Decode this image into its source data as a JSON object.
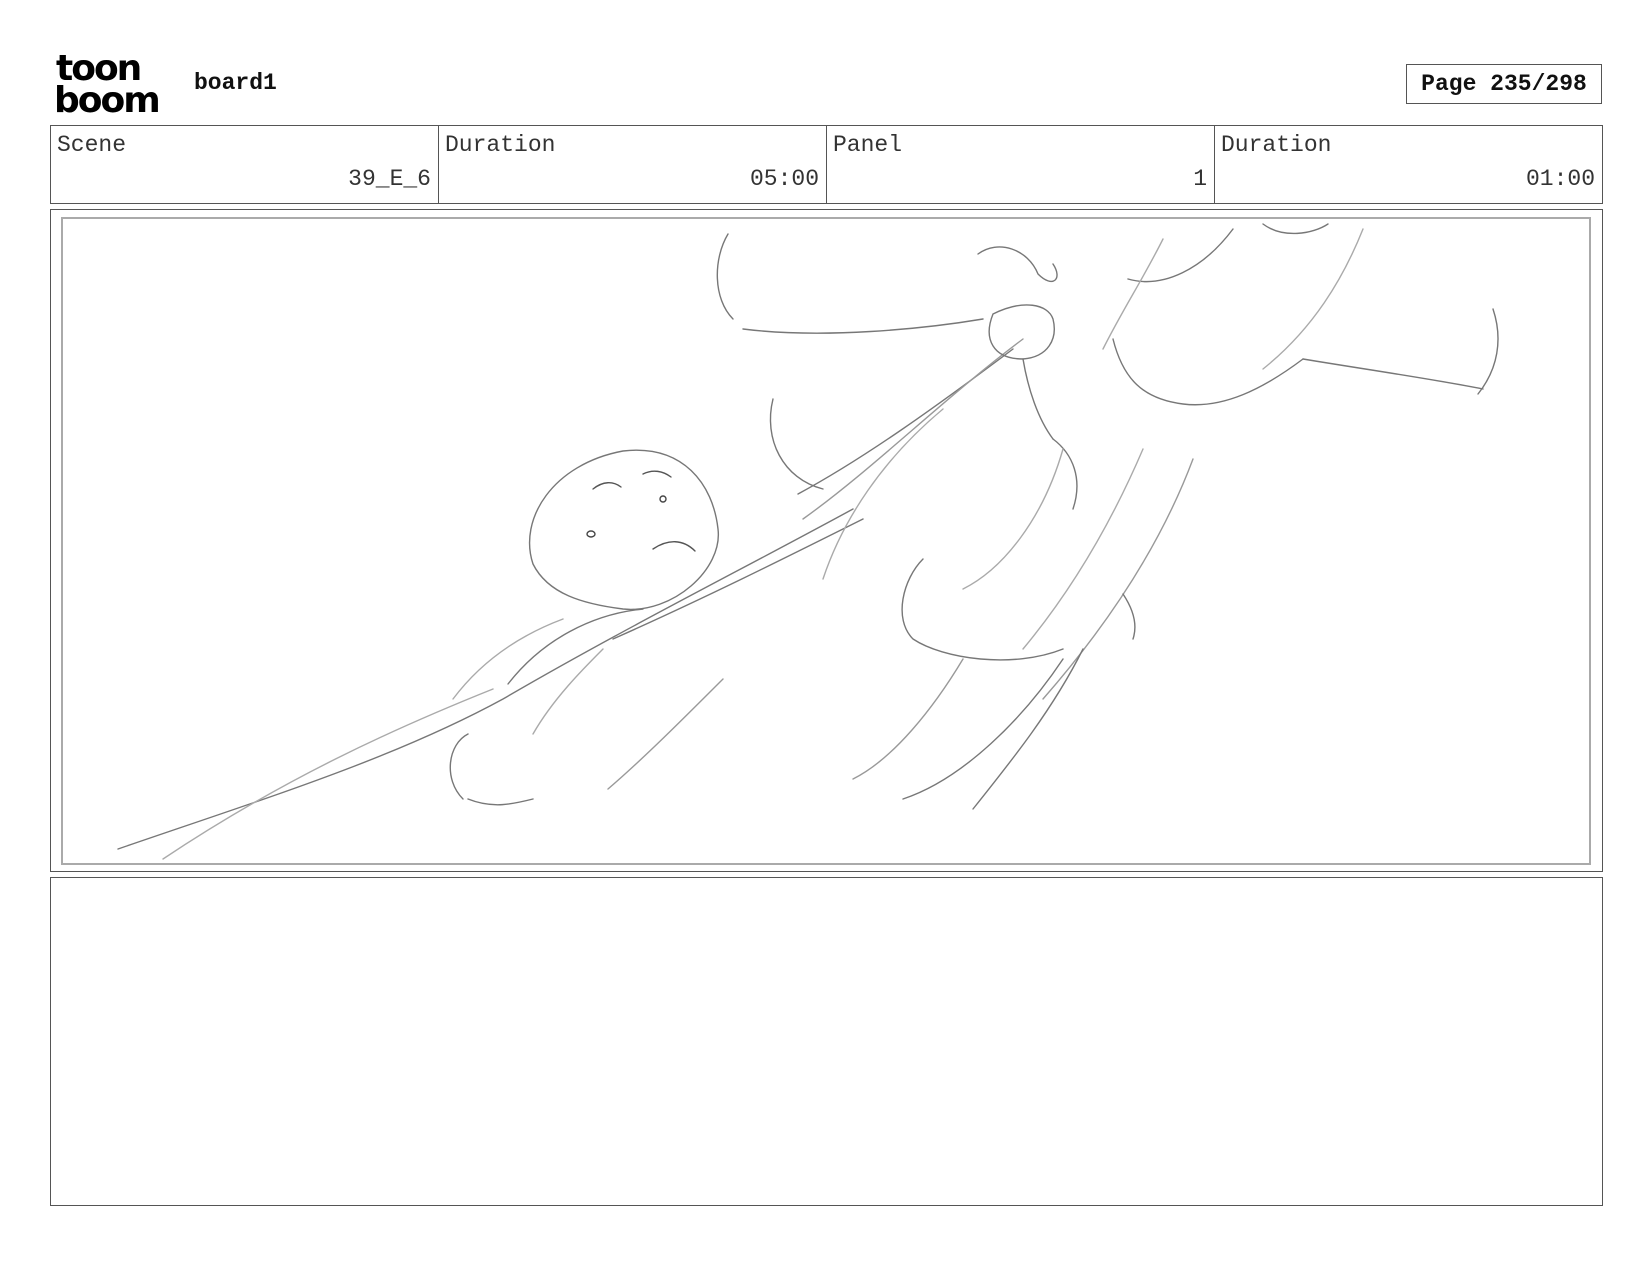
{
  "header": {
    "logo_line1": "toon",
    "logo_line2": "boom",
    "board_title": "board1",
    "page_label": "Page 235/298"
  },
  "info": {
    "scene_label": "Scene",
    "scene_value": "39_E_6",
    "scene_duration_label": "Duration",
    "scene_duration_value": "05:00",
    "panel_label": "Panel",
    "panel_value": "1",
    "panel_duration_label": "Duration",
    "panel_duration_value": "01:00"
  },
  "notes": {
    "text": ""
  }
}
